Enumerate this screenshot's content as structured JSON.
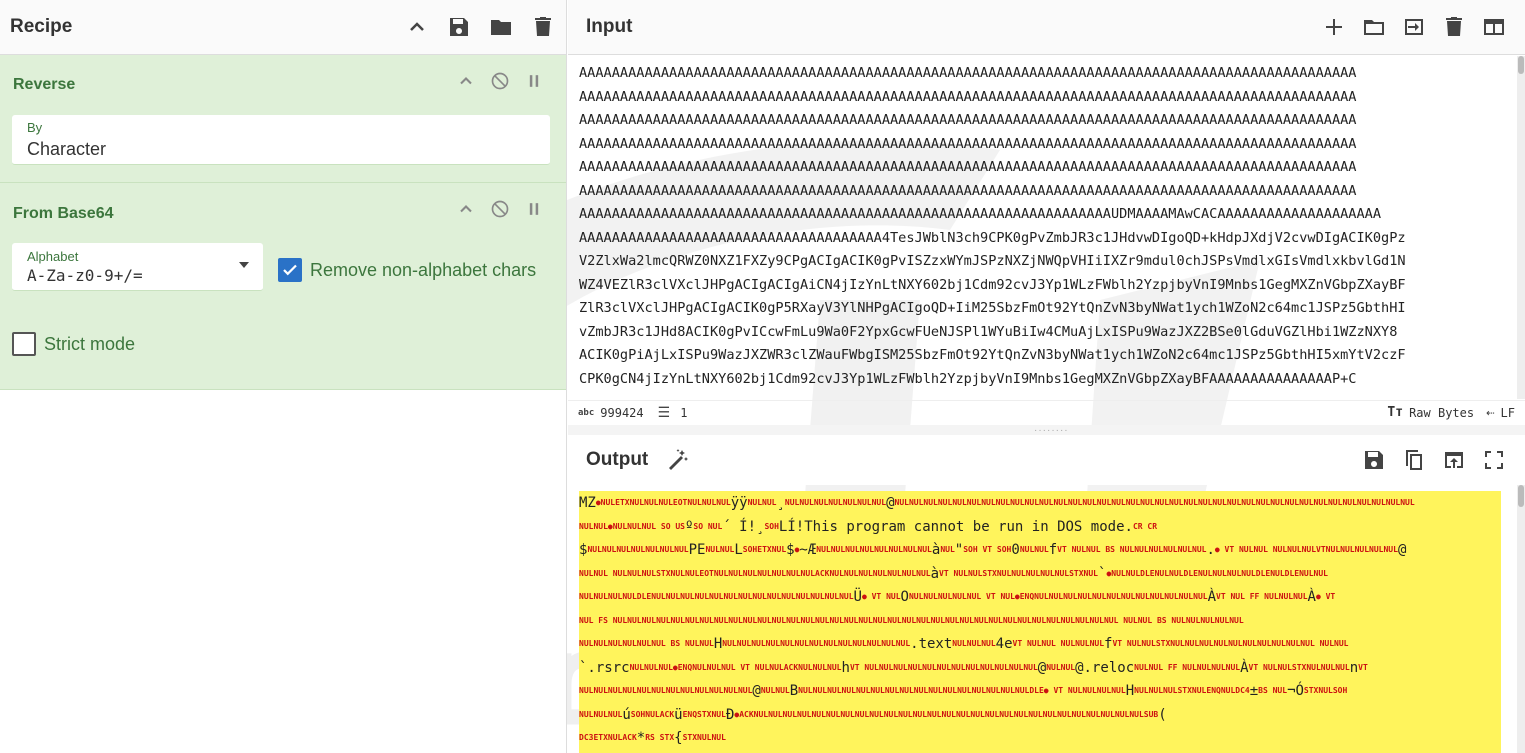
{
  "recipe": {
    "title": "Recipe",
    "header_icons": [
      "chevron-up-icon",
      "save-icon",
      "folder-icon",
      "trash-icon"
    ],
    "operations": [
      {
        "title": "Reverse",
        "by_label": "By",
        "by_value": "Character"
      },
      {
        "title": "From Base64",
        "alphabet_label": "Alphabet",
        "alphabet_value": "A-Za-z0-9+/=",
        "remove_nonalpha_label": "Remove non-alphabet chars",
        "remove_nonalpha_checked": true,
        "strict_mode_label": "Strict mode",
        "strict_mode_checked": false
      }
    ]
  },
  "input": {
    "title": "Input",
    "lines": [
      "AAAAAAAAAAAAAAAAAAAAAAAAAAAAAAAAAAAAAAAAAAAAAAAAAAAAAAAAAAAAAAAAAAAAAAAAAAAAAAAAAAAAAAAAAAAAAAA",
      "AAAAAAAAAAAAAAAAAAAAAAAAAAAAAAAAAAAAAAAAAAAAAAAAAAAAAAAAAAAAAAAAAAAAAAAAAAAAAAAAAAAAAAAAAAAAAAA",
      "AAAAAAAAAAAAAAAAAAAAAAAAAAAAAAAAAAAAAAAAAAAAAAAAAAAAAAAAAAAAAAAAAAAAAAAAAAAAAAAAAAAAAAAAAAAAAAA",
      "AAAAAAAAAAAAAAAAAAAAAAAAAAAAAAAAAAAAAAAAAAAAAAAAAAAAAAAAAAAAAAAAAAAAAAAAAAAAAAAAAAAAAAAAAAAAAAA",
      "AAAAAAAAAAAAAAAAAAAAAAAAAAAAAAAAAAAAAAAAAAAAAAAAAAAAAAAAAAAAAAAAAAAAAAAAAAAAAAAAAAAAAAAAAAAAAAA",
      "AAAAAAAAAAAAAAAAAAAAAAAAAAAAAAAAAAAAAAAAAAAAAAAAAAAAAAAAAAAAAAAAAAAAAAAAAAAAAAAAAAAAAAAAAAAAAAA",
      "AAAAAAAAAAAAAAAAAAAAAAAAAAAAAAAAAAAAAAAAAAAAAAAAAAAAAAAAAAAAAAAAAUDMAAAAMAwCACAAAAAAAAAAAAAAAAAAAA",
      "AAAAAAAAAAAAAAAAAAAAAAAAAAAAAAAAAAAAA4TesJWblN3ch9CPK0gPvZmbJR3c1JHdvwDIgoQD+kHdpJXdjV2cvwDIgACIK0gPz",
      "V2ZlxWa2lmcQRWZ0NXZ1FXZy9CPgACIgACIK0gPvISZzxWYmJSPzNXZjNWQpVHIiIXZr9mdul0chJSPsVmdlxGIsVmdlxkbvlGd1N",
      "WZ4VEZlR3clVXclJHPgACIgACIgAiCN4jIzYnLtNXY602bj1Cdm92cvJ3Yp1WLzFWblh2YzpjbyVnI9Mnbs1GegMXZnVGbpZXayBF",
      "ZlR3clVXclJHPgACIgACIK0gP5RXayV3YlNHPgACIgoQD+IiM25SbzFmOt92YtQnZvN3byNWat1ych1WZoN2c64mc1JSPz5GbthHI",
      "vZmbJR3c1JHd8ACIK0gPvICcwFmLu9Wa0F2YpxGcwFUeNJSPl1WYuBiIw4CMuAjLxISPu9WazJXZ2BSe0lGduVGZlHbi1WZzNXY8",
      "ACIK0gPiAjLxISPu9WazJXZWR3clZWauFWbgISM25SbzFmOt92YtQnZvN3byNWat1ych1WZoN2c64mc1JSPz5GbthHI5xmYtV2czF",
      "CPK0gCN4jIzYnLtNXY602bj1Cdm92cvJ3Yp1WLzFWblh2YzpjbyVnI9Mnbs1GegMXZnVGbpZXayBFAAAAAAAAAAAAAAAP+C"
    ],
    "scroll_fraction": 0.0,
    "status": {
      "abc_icon": "abc",
      "length": "999424",
      "lines_icon": "lines-icon",
      "lines": "1",
      "format_icon": "Tт",
      "format": "Raw Bytes",
      "eol_icon": "return-arrow-icon",
      "eol": "LF"
    }
  },
  "output": {
    "title": "Output"
  }
}
